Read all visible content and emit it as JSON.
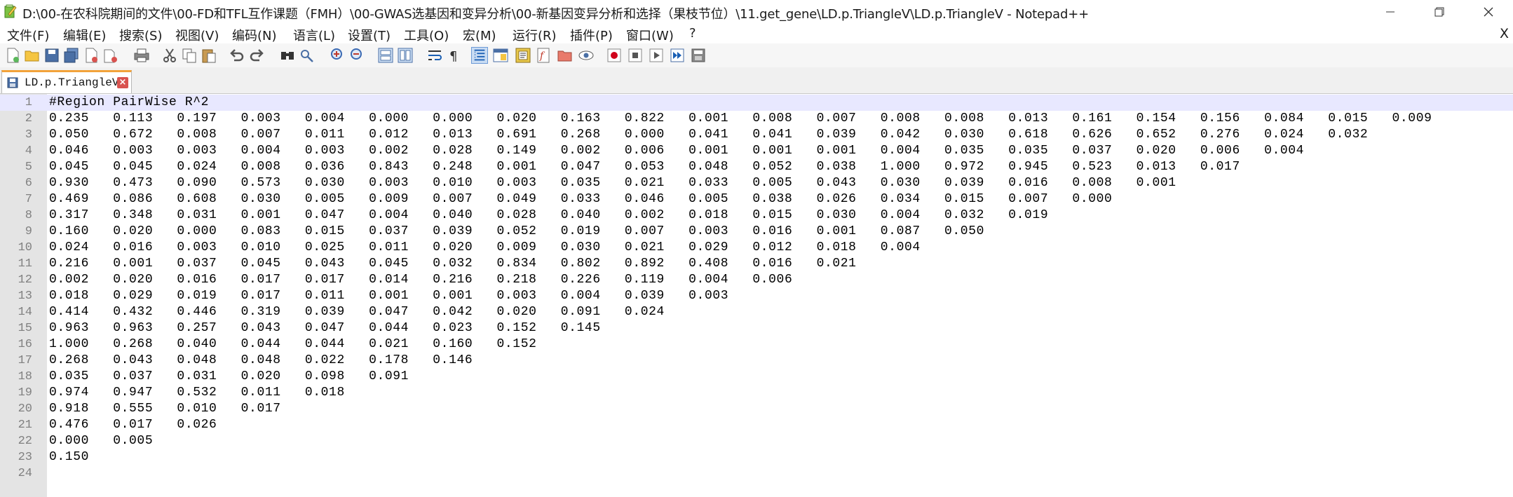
{
  "window": {
    "title": "D:\\00-在农科院期间的文件\\00-FD和TFL互作课题（FMH）\\00-GWAS选基因和变异分析\\00-新基因变异分析和选择（果枝节位）\\11.get_gene\\LD.p.TriangleV\\LD.p.TriangleV - Notepad++",
    "minimize_glyph": "—",
    "restore_glyph": "❐",
    "close_glyph": "✕"
  },
  "menu": {
    "items": [
      "文件(F)",
      "编辑(E)",
      "搜索(S)",
      "视图(V)",
      "编码(N)",
      "语言(L)",
      "设置(T)",
      "工具(O)",
      "宏(M)",
      "运行(R)",
      "插件(P)",
      "窗口(W)",
      "?"
    ],
    "close_label": "X"
  },
  "toolbar": {
    "icons": [
      "new-file-icon",
      "open-file-icon",
      "save-icon",
      "save-all-icon",
      "close-icon",
      "close-all-icon",
      "print-icon",
      "cut-icon",
      "copy-icon",
      "paste-icon",
      "undo-icon",
      "redo-icon",
      "find-icon",
      "replace-icon",
      "zoom-in-icon",
      "zoom-out-icon",
      "sync-vertical-icon",
      "sync-horizontal-icon",
      "word-wrap-icon",
      "show-all-chars-icon",
      "indent-guide-icon",
      "udl-icon",
      "doc-map-icon",
      "function-list-icon",
      "folder-workspace-icon",
      "monitoring-icon",
      "macro-record-icon",
      "macro-stop-icon",
      "macro-play-icon",
      "macro-run-multiple-icon",
      "macro-save-icon"
    ]
  },
  "tab": {
    "label": "LD.p.TriangleV"
  },
  "editor": {
    "current_line": 1,
    "lines": [
      "#Region PairWise R^2",
      "0.235   0.113   0.197   0.003   0.004   0.000   0.000   0.020   0.163   0.822   0.001   0.008   0.007   0.008   0.008   0.013   0.161   0.154   0.156   0.084   0.015   0.009",
      "0.050   0.672   0.008   0.007   0.011   0.012   0.013   0.691   0.268   0.000   0.041   0.041   0.039   0.042   0.030   0.618   0.626   0.652   0.276   0.024   0.032",
      "0.046   0.003   0.003   0.004   0.003   0.002   0.028   0.149   0.002   0.006   0.001   0.001   0.001   0.004   0.035   0.035   0.037   0.020   0.006   0.004",
      "0.045   0.045   0.024   0.008   0.036   0.843   0.248   0.001   0.047   0.053   0.048   0.052   0.038   1.000   0.972   0.945   0.523   0.013   0.017",
      "0.930   0.473   0.090   0.573   0.030   0.003   0.010   0.003   0.035   0.021   0.033   0.005   0.043   0.030   0.039   0.016   0.008   0.001",
      "0.469   0.086   0.608   0.030   0.005   0.009   0.007   0.049   0.033   0.046   0.005   0.038   0.026   0.034   0.015   0.007   0.000",
      "0.317   0.348   0.031   0.001   0.047   0.004   0.040   0.028   0.040   0.002   0.018   0.015   0.030   0.004   0.032   0.019",
      "0.160   0.020   0.000   0.083   0.015   0.037   0.039   0.052   0.019   0.007   0.003   0.016   0.001   0.087   0.050",
      "0.024   0.016   0.003   0.010   0.025   0.011   0.020   0.009   0.030   0.021   0.029   0.012   0.018   0.004",
      "0.216   0.001   0.037   0.045   0.043   0.045   0.032   0.834   0.802   0.892   0.408   0.016   0.021",
      "0.002   0.020   0.016   0.017   0.017   0.014   0.216   0.218   0.226   0.119   0.004   0.006",
      "0.018   0.029   0.019   0.017   0.011   0.001   0.001   0.003   0.004   0.039   0.003",
      "0.414   0.432   0.446   0.319   0.039   0.047   0.042   0.020   0.091   0.024",
      "0.963   0.963   0.257   0.043   0.047   0.044   0.023   0.152   0.145",
      "1.000   0.268   0.040   0.044   0.044   0.021   0.160   0.152",
      "0.268   0.043   0.048   0.048   0.022   0.178   0.146",
      "0.035   0.037   0.031   0.020   0.098   0.091",
      "0.974   0.947   0.532   0.011   0.018",
      "0.918   0.555   0.010   0.017",
      "0.476   0.017   0.026",
      "0.000   0.005",
      "0.150",
      ""
    ]
  }
}
